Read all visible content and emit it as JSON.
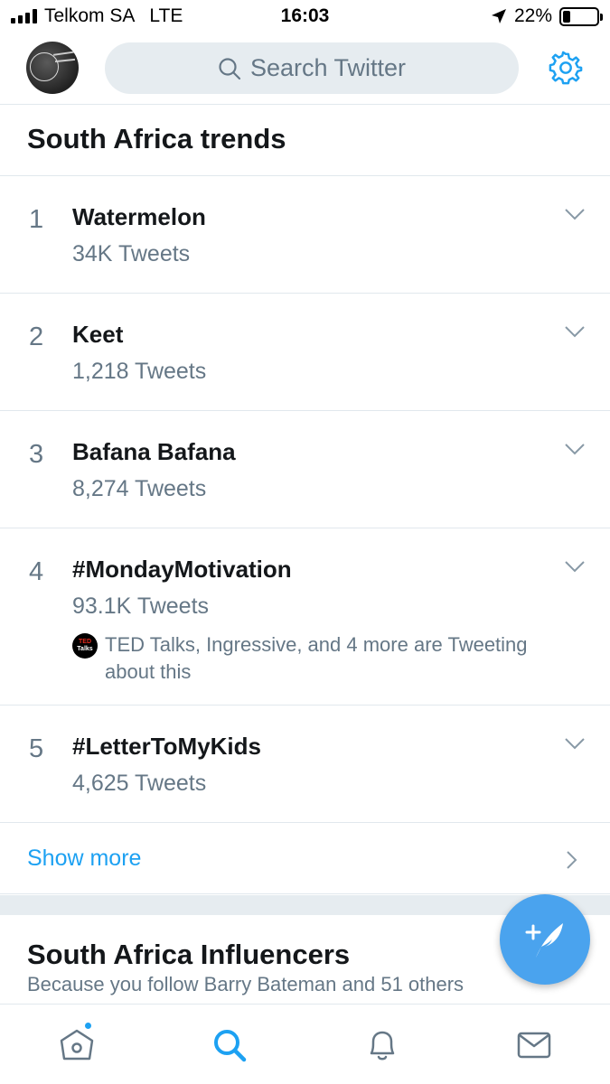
{
  "status_bar": {
    "carrier": "Telkom SA",
    "network": "LTE",
    "time": "16:03",
    "battery_percent_text": "22%",
    "battery_level": 0.22
  },
  "header": {
    "search_placeholder": "Search Twitter",
    "accent_color": "#1da1f2"
  },
  "section_title": "South Africa trends",
  "trends": [
    {
      "rank": "1",
      "name": "Watermelon",
      "count": "34K Tweets"
    },
    {
      "rank": "2",
      "name": "Keet",
      "count": "1,218 Tweets"
    },
    {
      "rank": "3",
      "name": "Bafana Bafana",
      "count": "8,274 Tweets"
    },
    {
      "rank": "4",
      "name": "#MondayMotivation",
      "count": "93.1K Tweets",
      "context": "TED Talks, Ingressive, and 4 more are Tweeting about this",
      "context_avatar_text": "TED",
      "context_avatar_subtext": "Talks"
    },
    {
      "rank": "5",
      "name": "#LetterToMyKids",
      "count": "4,625 Tweets"
    }
  ],
  "show_more_label": "Show more",
  "influencers": {
    "title": "South Africa Influencers",
    "subtitle": "Because you follow Barry Bateman and 51 others"
  },
  "icons": {
    "search": "search-icon",
    "settings": "gear-icon",
    "chevron": "chevron-down-icon",
    "compose": "compose-tweet-icon",
    "home": "home-icon",
    "explore": "search-tab-icon",
    "notifications": "bell-icon",
    "messages": "envelope-icon"
  }
}
